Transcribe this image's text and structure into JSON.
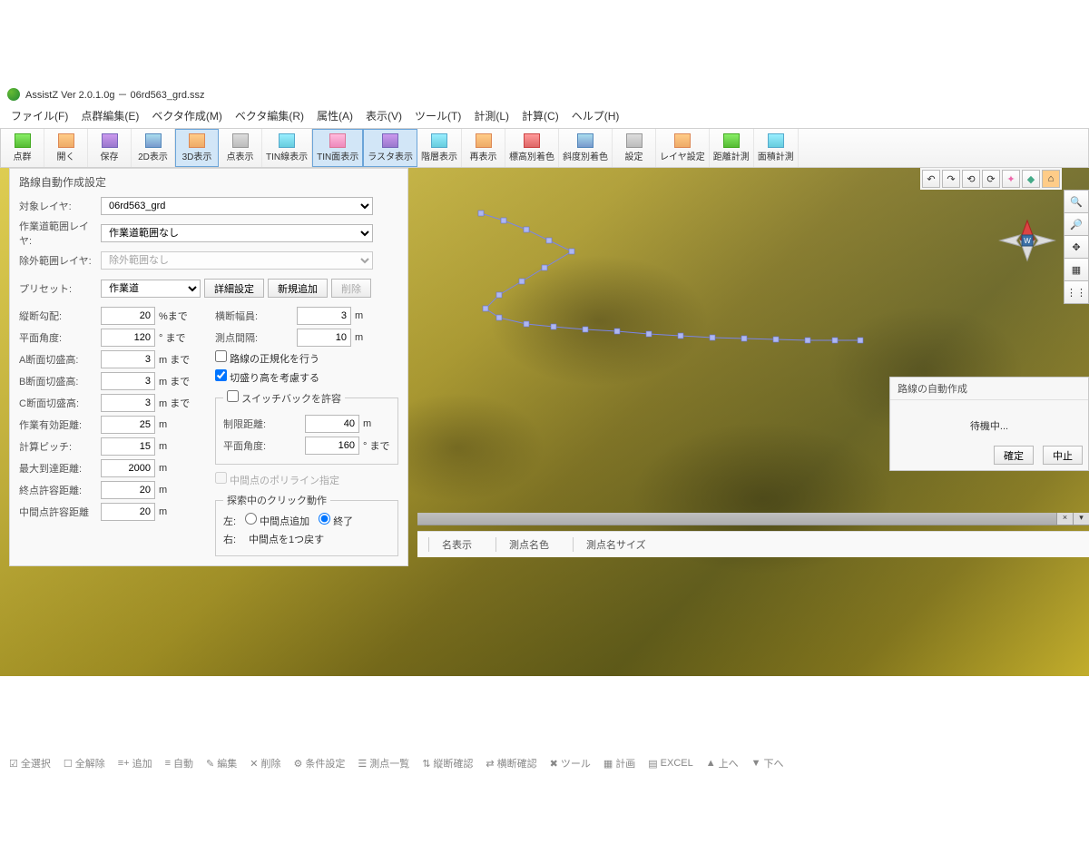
{
  "title": "AssistZ  Ver 2.0.1.0g － 06rd563_grd.ssz",
  "menu": [
    "ファイル(F)",
    "点群編集(E)",
    "ベクタ作成(M)",
    "ベクタ編集(R)",
    "属性(A)",
    "表示(V)",
    "ツール(T)",
    "計測(L)",
    "計算(C)",
    "ヘルプ(H)"
  ],
  "toolbar": [
    {
      "label": "点群",
      "cls": "ic-green"
    },
    {
      "label": "開く",
      "cls": "ic-orange"
    },
    {
      "label": "保存",
      "cls": "ic-purple"
    },
    {
      "label": "2D表示",
      "cls": "ic-blue"
    },
    {
      "label": "3D表示",
      "cls": "ic-orange",
      "hl": true
    },
    {
      "label": "点表示",
      "cls": "ic-grey"
    },
    {
      "label": "TIN線表示",
      "cls": "ic-cyan"
    },
    {
      "label": "TIN面表示",
      "cls": "ic-pink",
      "hl": true
    },
    {
      "label": "ラスタ表示",
      "cls": "ic-purple",
      "hl": true
    },
    {
      "label": "階層表示",
      "cls": "ic-cyan"
    },
    {
      "label": "再表示",
      "cls": "ic-orange"
    },
    {
      "label": "標高別着色",
      "cls": "ic-red"
    },
    {
      "label": "斜度別着色",
      "cls": "ic-blue"
    },
    {
      "label": "設定",
      "cls": "ic-grey"
    },
    {
      "label": "レイヤ設定",
      "cls": "ic-orange"
    },
    {
      "label": "距離計測",
      "cls": "ic-green"
    },
    {
      "label": "面積計測",
      "cls": "ic-cyan"
    }
  ],
  "panel": {
    "title": "路線自動作成設定",
    "fields": {
      "target_label": "対象レイヤ:",
      "target": "06rd563_grd",
      "work_label": "作業道範囲レイヤ:",
      "work": "作業道範囲なし",
      "exclude_label": "除外範囲レイヤ:",
      "exclude": "除外範囲なし",
      "preset_label": "プリセット:",
      "preset": "作業道",
      "detail_btn": "詳細設定",
      "new_btn": "新規追加",
      "del_btn": "削除"
    },
    "left": [
      {
        "label": "縦断勾配:",
        "value": "20",
        "unit": "%まで"
      },
      {
        "label": "平面角度:",
        "value": "120",
        "unit": "° まで"
      },
      {
        "label": "A断面切盛高:",
        "value": "3",
        "unit": "m まで"
      },
      {
        "label": "B断面切盛高:",
        "value": "3",
        "unit": "m まで"
      },
      {
        "label": "C断面切盛高:",
        "value": "3",
        "unit": "m まで"
      },
      {
        "label": "作業有効距離:",
        "value": "25",
        "unit": "m"
      },
      {
        "label": "計算ピッチ:",
        "value": "15",
        "unit": "m"
      },
      {
        "label": "最大到達距離:",
        "value": "2000",
        "unit": "m"
      },
      {
        "label": "終点許容距離:",
        "value": "20",
        "unit": "m"
      },
      {
        "label": "中間点許容距離",
        "value": "20",
        "unit": "m"
      }
    ],
    "right_top": [
      {
        "label": "横断幅員:",
        "value": "3",
        "unit": "m"
      },
      {
        "label": "測点間隔:",
        "value": "10",
        "unit": "m"
      }
    ],
    "check1": "路線の正規化を行う",
    "check2": "切盛り高を考慮する",
    "switchback": {
      "legend": "スイッチバックを許容",
      "items": [
        {
          "label": "制限距離:",
          "value": "40",
          "unit": "m"
        },
        {
          "label": "平面角度:",
          "value": "160",
          "unit": "° まで"
        }
      ]
    },
    "midpoly": "中間点のポリライン指定",
    "clickops": {
      "legend": "探索中のクリック動作",
      "left_label": "左:",
      "left_add": "中間点追加",
      "left_end": "終了",
      "right_label": "右:",
      "right_text": "中間点を1つ戻す"
    }
  },
  "tabs": [
    "名表示",
    "測点名色",
    "測点名サイズ"
  ],
  "dialog": {
    "title": "路線の自動作成",
    "body": "待機中...",
    "ok": "確定",
    "cancel": "中止"
  },
  "bottom": [
    "全選択",
    "全解除",
    "追加",
    "自動",
    "編集",
    "削除",
    "条件設定",
    "測点一覧",
    "縦断確認",
    "横断確認",
    "ツール",
    "計画",
    "EXCEL",
    "上へ",
    "下へ"
  ]
}
